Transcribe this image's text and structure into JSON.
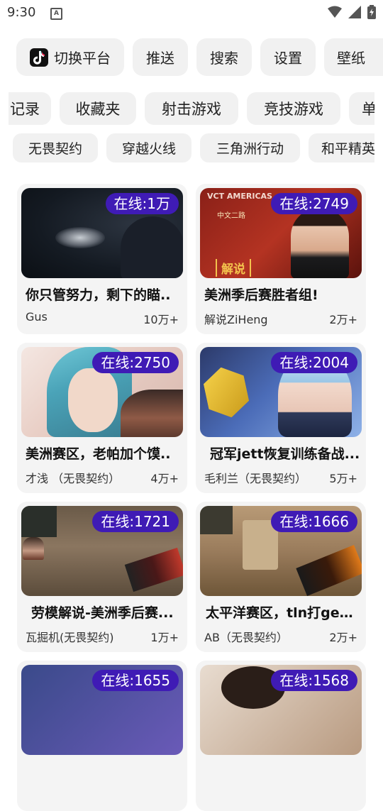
{
  "status_bar": {
    "time": "9:30",
    "notification_icon": "A"
  },
  "row1": [
    {
      "label": "切换平台",
      "icon": "tiktok-icon"
    },
    {
      "label": "推送"
    },
    {
      "label": "搜索"
    },
    {
      "label": "设置"
    },
    {
      "label": "壁纸"
    }
  ],
  "row2": [
    "记录",
    "收藏夹",
    "射击游戏",
    "竞技游戏",
    "单"
  ],
  "row3": [
    "无畏契约",
    "穿越火线",
    "三角洲行动",
    "和平精英"
  ],
  "cards": [
    {
      "badge": "在线:1万",
      "title": "你只管努力，剩下的瞄..",
      "author": "Gus",
      "count": "10万+"
    },
    {
      "badge": "在线:2749",
      "title": "美洲季后赛胜者组!",
      "author": "解说ZiHeng",
      "count": "2万+",
      "thumb_text": "VCT AMERICAS",
      "thumb_sub": "中文二路",
      "thumb_tag": "解说"
    },
    {
      "badge": "在线:2750",
      "title": "美洲赛区，老帕加个馍..",
      "author": "才浅 （无畏契约）",
      "count": "4万+"
    },
    {
      "badge": "在线:2004",
      "title": "冠军jett恢复训练备战...",
      "author": "毛利兰（无畏契约）",
      "count": "5万+"
    },
    {
      "badge": "在线:1721",
      "title": "劳模解说-美洲季后赛...",
      "author": "瓦掘机(无畏契约)",
      "count": "1万+"
    },
    {
      "badge": "在线:1666",
      "title": "太平洋赛区，tln打gen...",
      "author": "AB（无畏契约）",
      "count": "2万+"
    },
    {
      "badge": "在线:1655"
    },
    {
      "badge": "在线:1568"
    }
  ]
}
